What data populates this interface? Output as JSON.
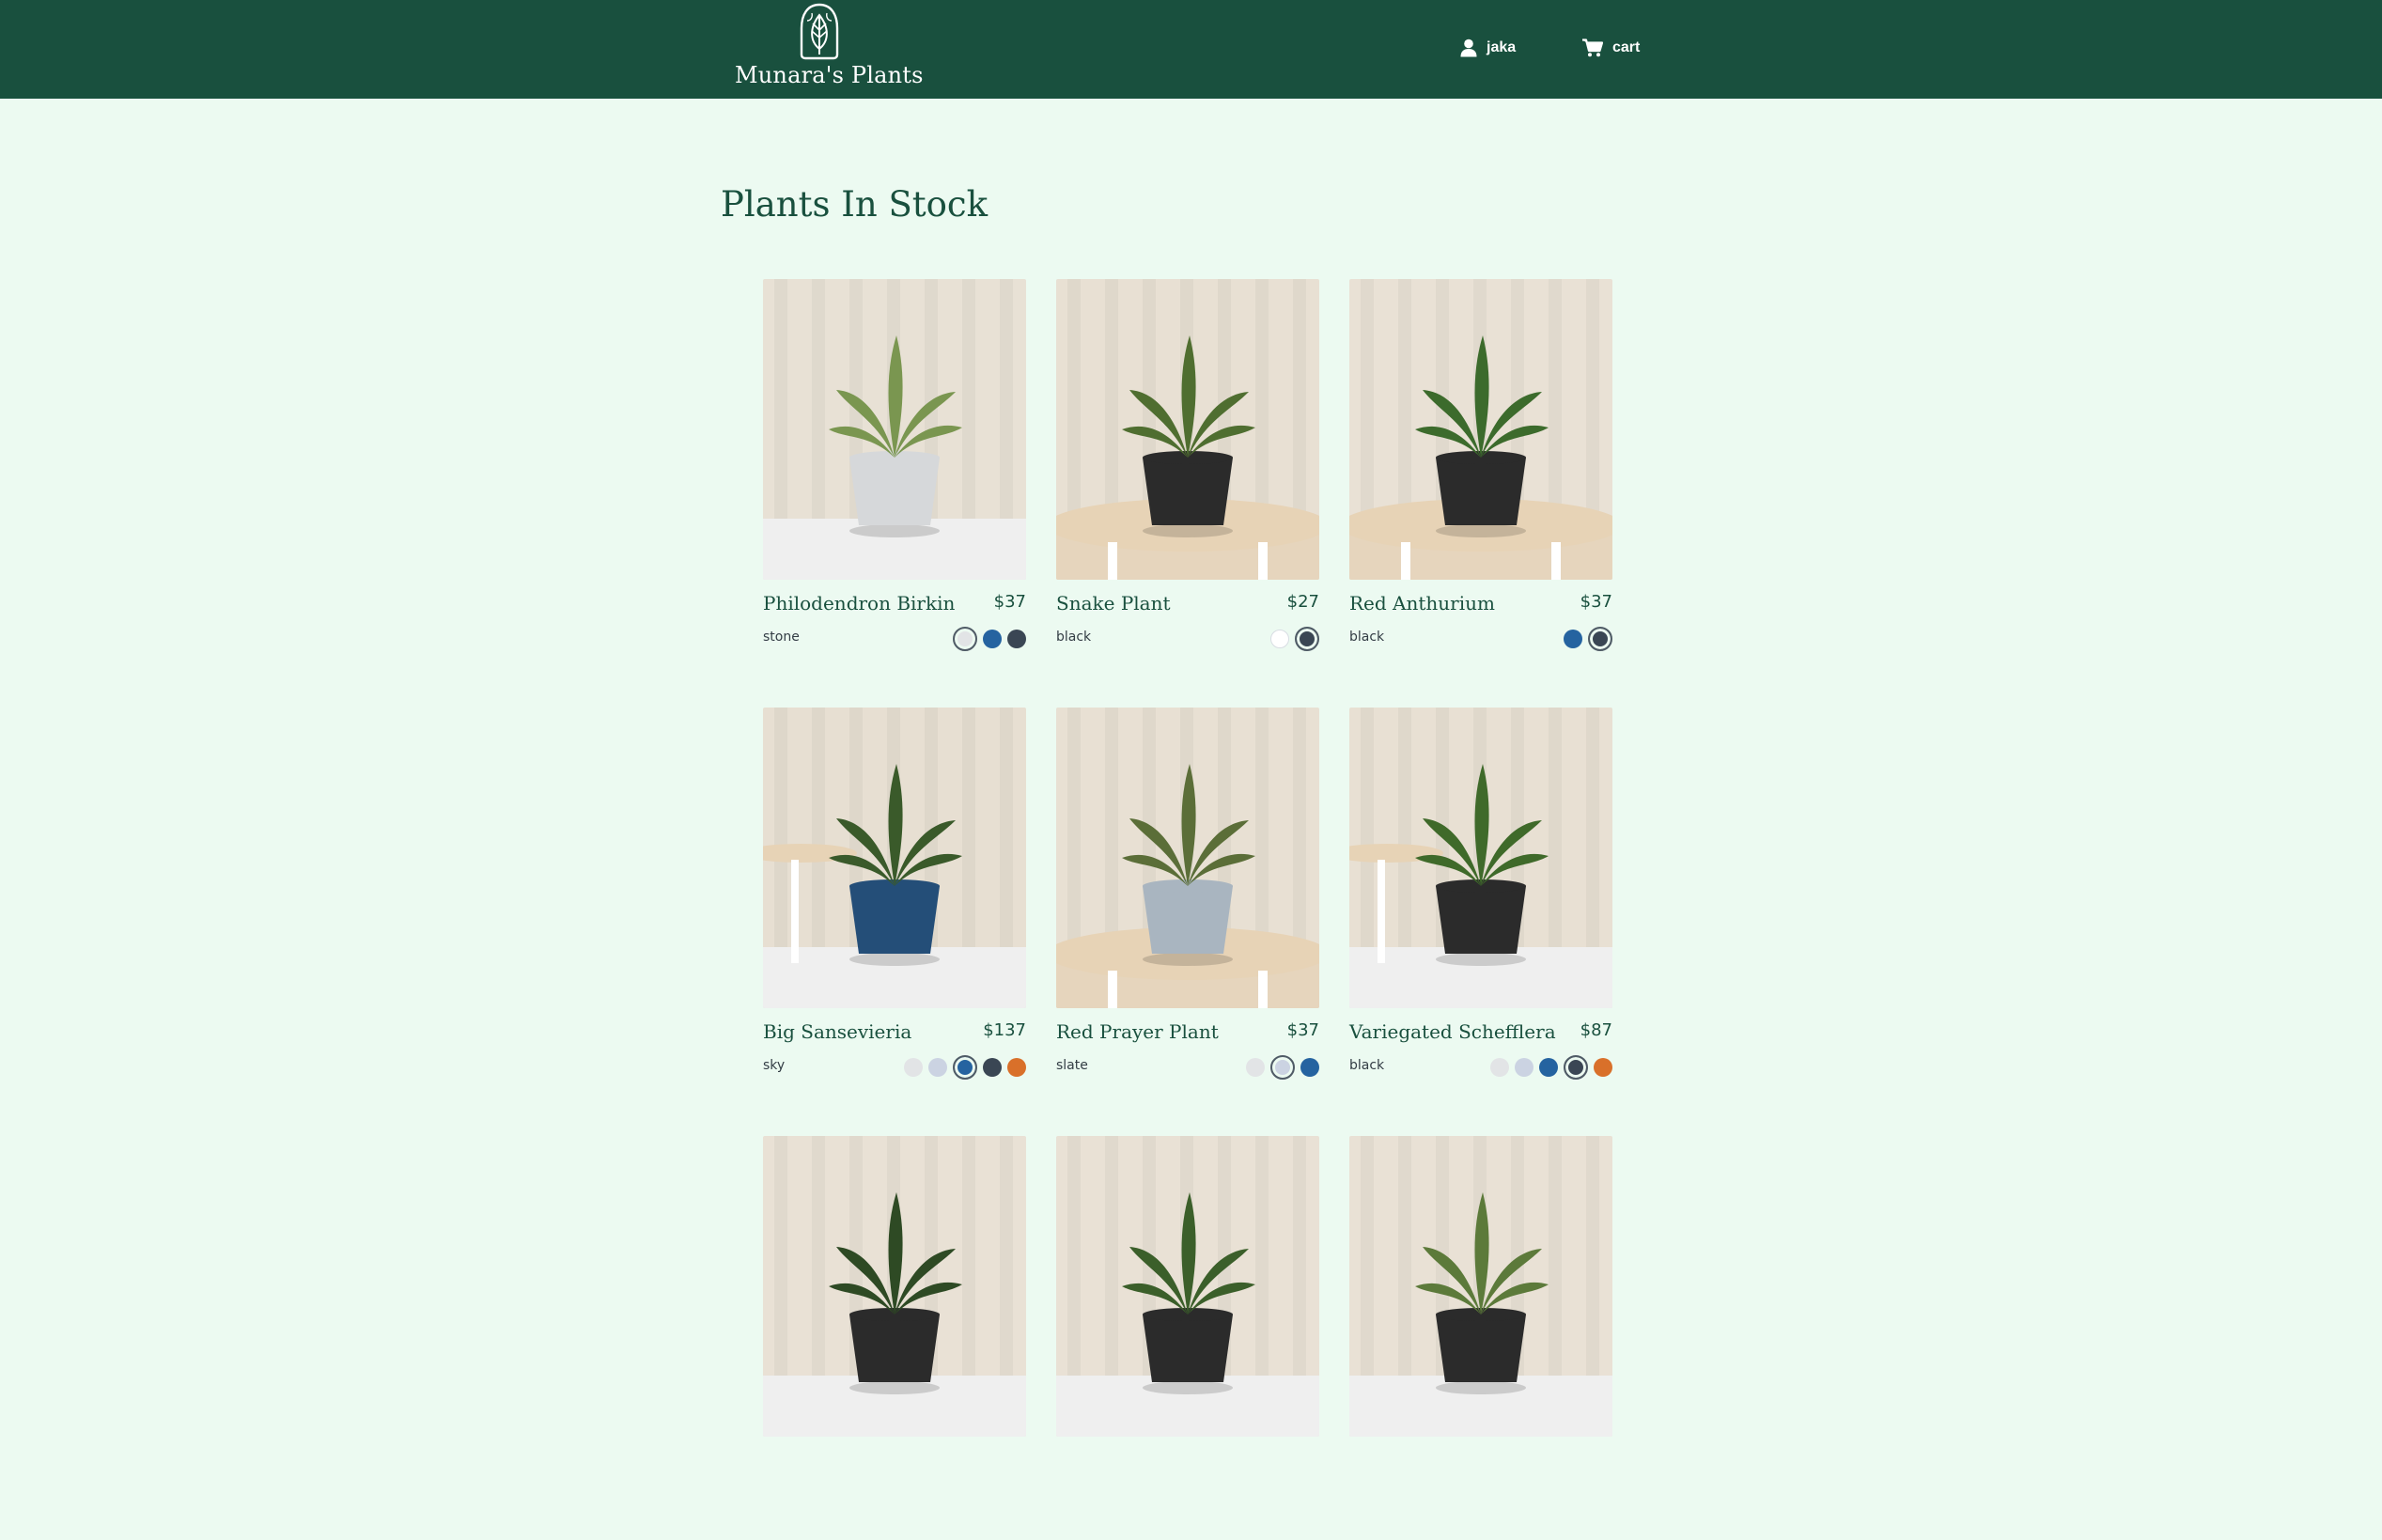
{
  "header": {
    "brand": "Munara's Plants",
    "user_label": "jaka",
    "cart_label": "cart",
    "icons": {
      "logo": "leaf-emblem-icon",
      "user": "user-icon",
      "cart": "shopping-cart-icon"
    }
  },
  "page": {
    "title": "Plants In Stock"
  },
  "colors": {
    "header_bg": "#19503e",
    "page_bg": "#ecfaf1",
    "accent_text": "#19503e",
    "swatches": {
      "stone": "#e2e4e6",
      "slate": "#cbd3e2",
      "sky": "#2563a0",
      "black": "#3a4654",
      "amber": "#d9702a",
      "white": "#ffffff"
    }
  },
  "products": [
    {
      "name": "Philodendron Birkin",
      "price": "$37",
      "color": "stone",
      "swatches": [
        {
          "color": "#e2e4e6",
          "selected": true
        },
        {
          "color": "#2563a0"
        },
        {
          "color": "#3a4654"
        }
      ],
      "photo": {
        "backdrop": "#e8e1d5",
        "floor": "#efefef",
        "pot": "#d6d8da",
        "plant": "#7a9650",
        "furniture": "none"
      }
    },
    {
      "name": "Snake Plant",
      "price": "$27",
      "color": "black",
      "swatches": [
        {
          "color": "#ffffff"
        },
        {
          "color": "#3a4654",
          "selected": true
        }
      ],
      "photo": {
        "backdrop": "#e8e0d3",
        "floor": "#e6d5bd",
        "pot": "#2b2b2b",
        "plant": "#4f6e30",
        "furniture": "table"
      }
    },
    {
      "name": "Red Anthurium",
      "price": "$37",
      "color": "black",
      "swatches": [
        {
          "color": "#2563a0"
        },
        {
          "color": "#3a4654",
          "selected": true
        }
      ],
      "photo": {
        "backdrop": "#e9e1d5",
        "floor": "#e6d5bd",
        "pot": "#2b2b2b",
        "plant": "#3c6b2c",
        "furniture": "table"
      }
    },
    {
      "name": "Big Sansevieria",
      "price": "$137",
      "color": "sky",
      "swatches": [
        {
          "color": "#e2e4e6"
        },
        {
          "color": "#cbd3e2"
        },
        {
          "color": "#2563a0",
          "selected": true
        },
        {
          "color": "#3a4654"
        },
        {
          "color": "#d9702a"
        }
      ],
      "photo": {
        "backdrop": "#e7dfd2",
        "floor": "#efefef",
        "pot": "#244e78",
        "plant": "#3a5a2a",
        "furniture": "side-table"
      }
    },
    {
      "name": "Red Prayer Plant",
      "price": "$37",
      "color": "slate",
      "swatches": [
        {
          "color": "#e2e4e6"
        },
        {
          "color": "#cbd3e2",
          "selected": true
        },
        {
          "color": "#2563a0"
        }
      ],
      "photo": {
        "backdrop": "#e8e0d3",
        "floor": "#e6d5bd",
        "pot": "#a9b5c0",
        "plant": "#5b6e38",
        "furniture": "table"
      }
    },
    {
      "name": "Variegated Schefflera",
      "price": "$87",
      "color": "black",
      "swatches": [
        {
          "color": "#e2e4e6"
        },
        {
          "color": "#cbd3e2"
        },
        {
          "color": "#2563a0"
        },
        {
          "color": "#3a4654",
          "selected": true
        },
        {
          "color": "#d9702a"
        }
      ],
      "photo": {
        "backdrop": "#e8e0d3",
        "floor": "#efefef",
        "pot": "#2b2b2b",
        "plant": "#3f6a2a",
        "furniture": "side-table"
      }
    },
    {
      "name": "",
      "price": "",
      "color": "",
      "swatches": [],
      "photo": {
        "backdrop": "#e9e1d5",
        "floor": "#efefef",
        "pot": "#2b2b2b",
        "plant": "#2e4a24",
        "furniture": "none"
      }
    },
    {
      "name": "",
      "price": "",
      "color": "",
      "swatches": [],
      "photo": {
        "backdrop": "#e9e1d5",
        "floor": "#efefef",
        "pot": "#2b2b2b",
        "plant": "#3b5f2a",
        "furniture": "none"
      }
    },
    {
      "name": "",
      "price": "",
      "color": "",
      "swatches": [],
      "photo": {
        "backdrop": "#e9e1d5",
        "floor": "#efefef",
        "pot": "#2b2b2b",
        "plant": "#5c7a3a",
        "furniture": "none"
      }
    }
  ]
}
